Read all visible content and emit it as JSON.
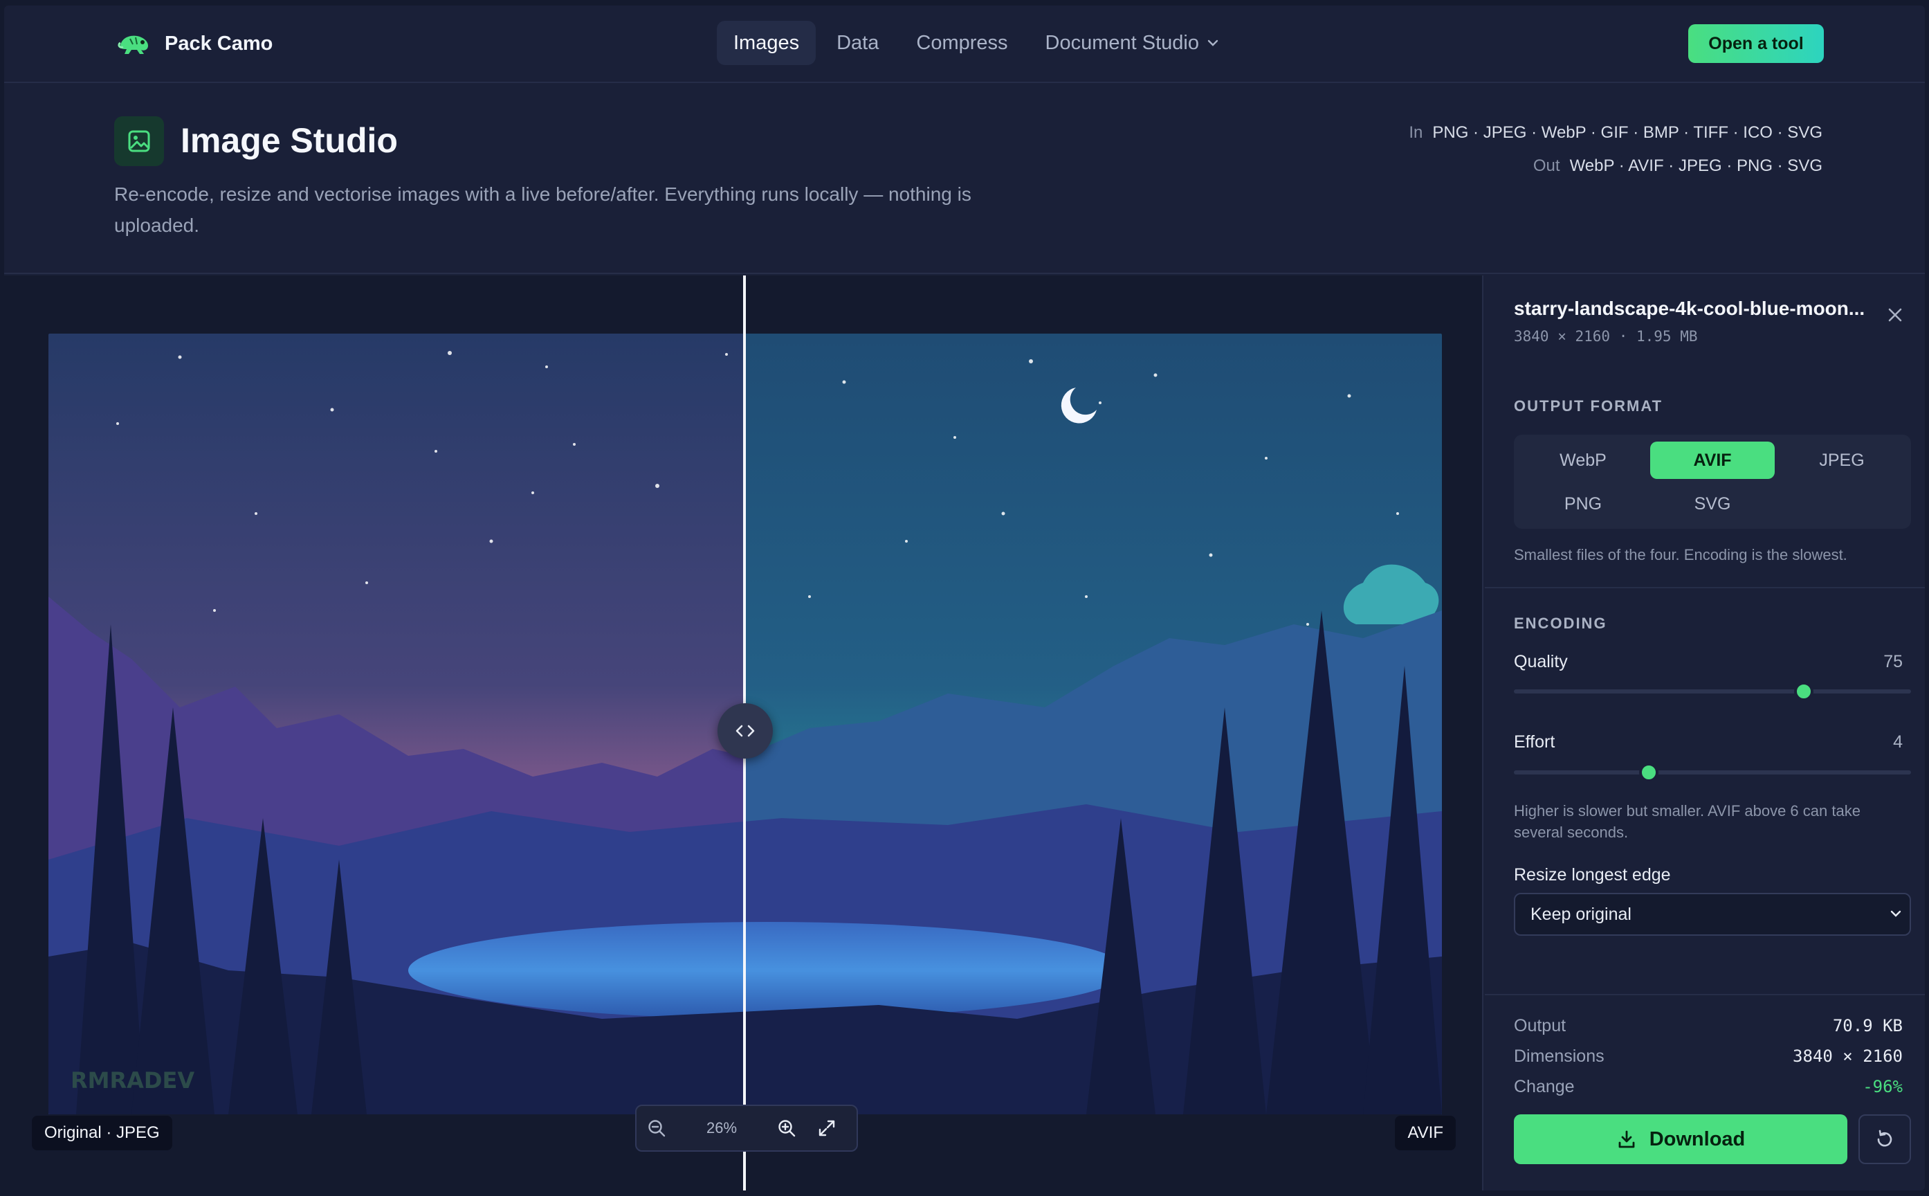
{
  "brand": {
    "name": "Pack Camo"
  },
  "nav": {
    "items": [
      {
        "label": "Images"
      },
      {
        "label": "Data"
      },
      {
        "label": "Compress"
      },
      {
        "label": "Document Studio"
      }
    ],
    "cta": "Open a tool"
  },
  "page": {
    "title": "Image Studio",
    "description": "Re-encode, resize and vectorise images with a live before/after. Everything runs locally — nothing is uploaded.",
    "in_label": "In",
    "in_formats": "PNG · JPEG · WebP · GIF · BMP · TIFF · ICO · SVG",
    "out_label": "Out",
    "out_formats": "WebP · AVIF · JPEG · PNG · SVG"
  },
  "viewer": {
    "left_tag": "Original · JPEG",
    "right_tag": "AVIF",
    "zoom": "26%",
    "watermark": "RMRADEV",
    "split_position": 0.5
  },
  "file": {
    "name": "starry-landscape-4k-cool-blue-moon...",
    "meta": "3840 × 2160 · 1.95 MB"
  },
  "output_format": {
    "label": "OUTPUT FORMAT",
    "options": [
      "WebP",
      "AVIF",
      "JPEG",
      "PNG",
      "SVG"
    ],
    "selected": "AVIF",
    "hint": "Smallest files of the four. Encoding is the slowest."
  },
  "encoding": {
    "label": "ENCODING",
    "quality_label": "Quality",
    "quality": "75",
    "quality_fraction": 0.73,
    "effort_label": "Effort",
    "effort": "4",
    "effort_fraction": 0.34,
    "hint": "Higher is slower but smaller. AVIF above 6 can take several seconds.",
    "resize_label": "Resize longest edge",
    "resize_value": "Keep original"
  },
  "stats": {
    "output_label": "Output",
    "output": "70.9 KB",
    "dimensions_label": "Dimensions",
    "dimensions": "3840 × 2160",
    "change_label": "Change",
    "change": "-96%"
  },
  "actions": {
    "download": "Download"
  },
  "colors": {
    "accent": "#4ade80",
    "background": "#1a2038"
  }
}
